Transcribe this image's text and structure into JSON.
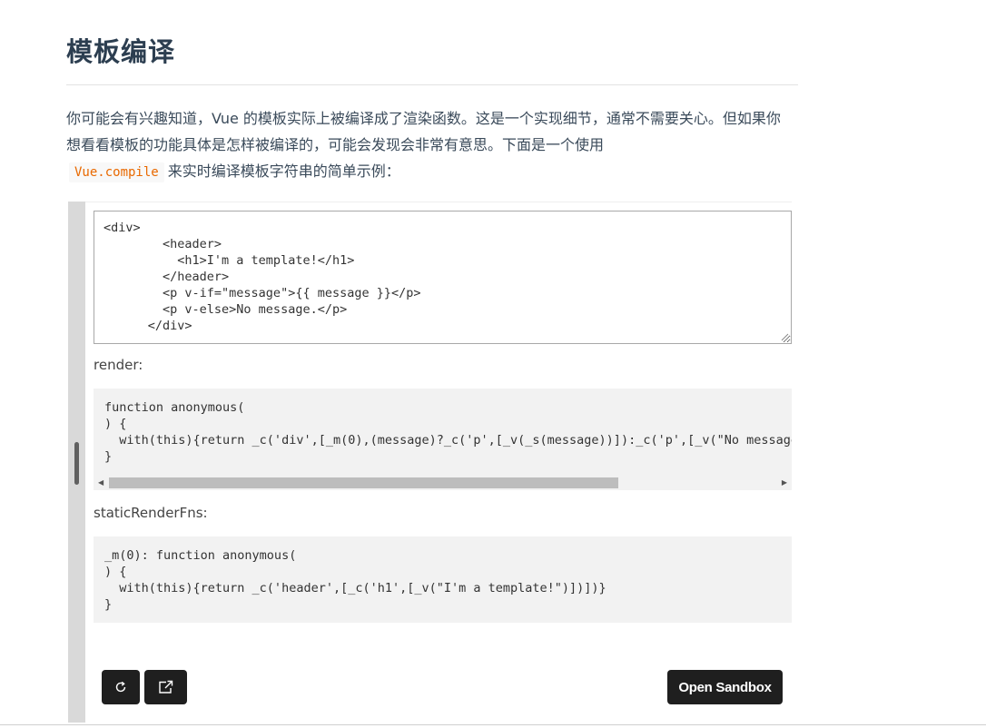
{
  "section": {
    "title": "模板编译",
    "intro_before": "你可能会有兴趣知道，Vue 的模板实际上被编译成了渲染函数。这是一个实现细节，通常不需要关心。但如果你想看看模板的功能具体是怎样被编译的，可能会发现会非常有意思。下面是一个使用",
    "intro_code": "Vue.compile",
    "intro_after": "来实时编译模板字符串的简单示例："
  },
  "demo": {
    "template_value": "<div>\n        <header>\n          <h1>I'm a template!</h1>\n        </header>\n        <p v-if=\"message\">{{ message }}</p>\n        <p v-else>No message.</p>\n      </div>",
    "render_label": "render:",
    "render_code": "function anonymous(\n) {\n  with(this){return _c('div',[_m(0),(message)?_c('p',[_v(_s(message))]):_c('p',[_v(\"No message.\")])])}\n}",
    "static_label": "staticRenderFns:",
    "static_code": "_m(0): function anonymous(\n) {\n  with(this){return _c('header',[_c('h1',[_v(\"I'm a template!\")])])}\n}"
  },
  "buttons": {
    "refresh_icon": "refresh-icon",
    "external_icon": "open-external-icon",
    "sandbox_label": "Open Sandbox"
  }
}
